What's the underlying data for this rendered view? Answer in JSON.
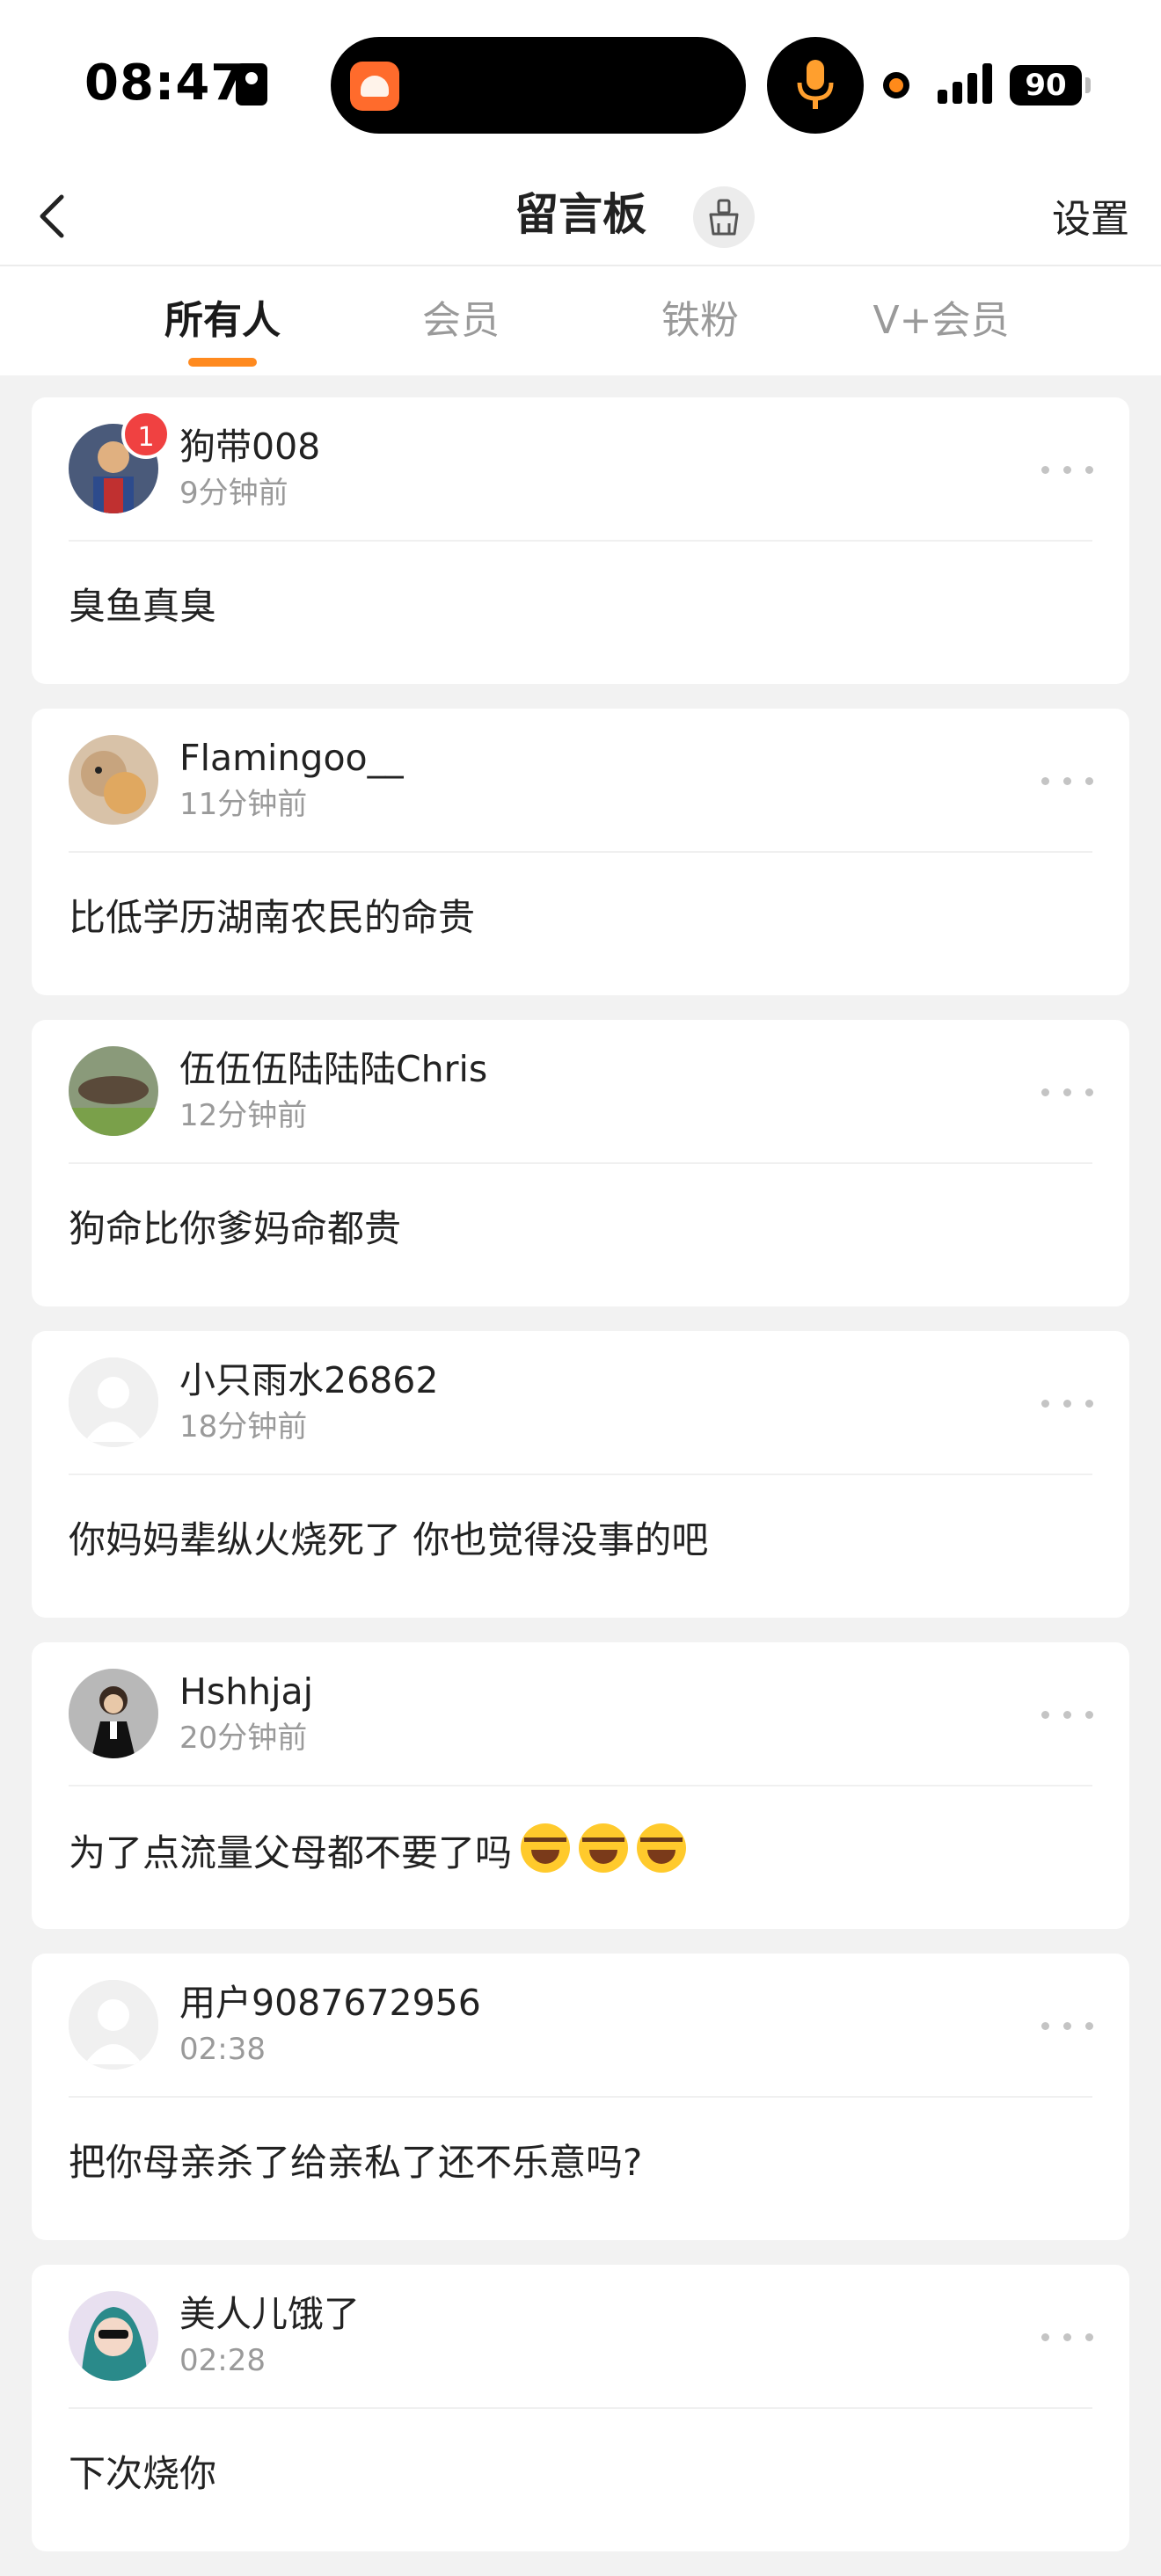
{
  "status_bar": {
    "time": "08:47",
    "battery": "90",
    "colors": {
      "mic": "#ff9f2e",
      "recording_dot": "#ff8a1a"
    }
  },
  "nav": {
    "title": "留言板",
    "settings_label": "设置"
  },
  "tabs": [
    {
      "label": "所有人",
      "active": true
    },
    {
      "label": "会员",
      "active": false
    },
    {
      "label": "铁粉",
      "active": false
    },
    {
      "label": "V+会员",
      "active": false
    }
  ],
  "accent_color": "#ff8a1f",
  "comments": [
    {
      "username": "狗带008",
      "time": "9分钟前",
      "message": "臭鱼真臭",
      "badge": "1",
      "avatar": "avatar-photo-icon"
    },
    {
      "username": "Flamingoo__",
      "time": "11分钟前",
      "message": "比低学历湖南农民的命贵",
      "avatar": "avatar-photo-icon"
    },
    {
      "username": "伍伍伍陆陆陆Chris",
      "time": "12分钟前",
      "message": "狗命比你爹妈命都贵",
      "avatar": "avatar-photo-icon"
    },
    {
      "username": "小只雨水26862",
      "time": "18分钟前",
      "message": "你妈妈辈纵火烧死了 你也觉得没事的吧",
      "avatar": "default-avatar-icon"
    },
    {
      "username": "Hshhjaj",
      "time": "20分钟前",
      "message": "为了点流量父母都不要了吗",
      "emoji_count": 3,
      "avatar": "avatar-photo-icon"
    },
    {
      "username": "用户9087672956",
      "time": "02:38",
      "message": "把你母亲杀了给亲私了还不乐意吗?",
      "avatar": "default-avatar-icon"
    },
    {
      "username": "美人儿饿了",
      "time": "02:28",
      "message": "下次烧你",
      "avatar": "avatar-photo-icon"
    }
  ]
}
